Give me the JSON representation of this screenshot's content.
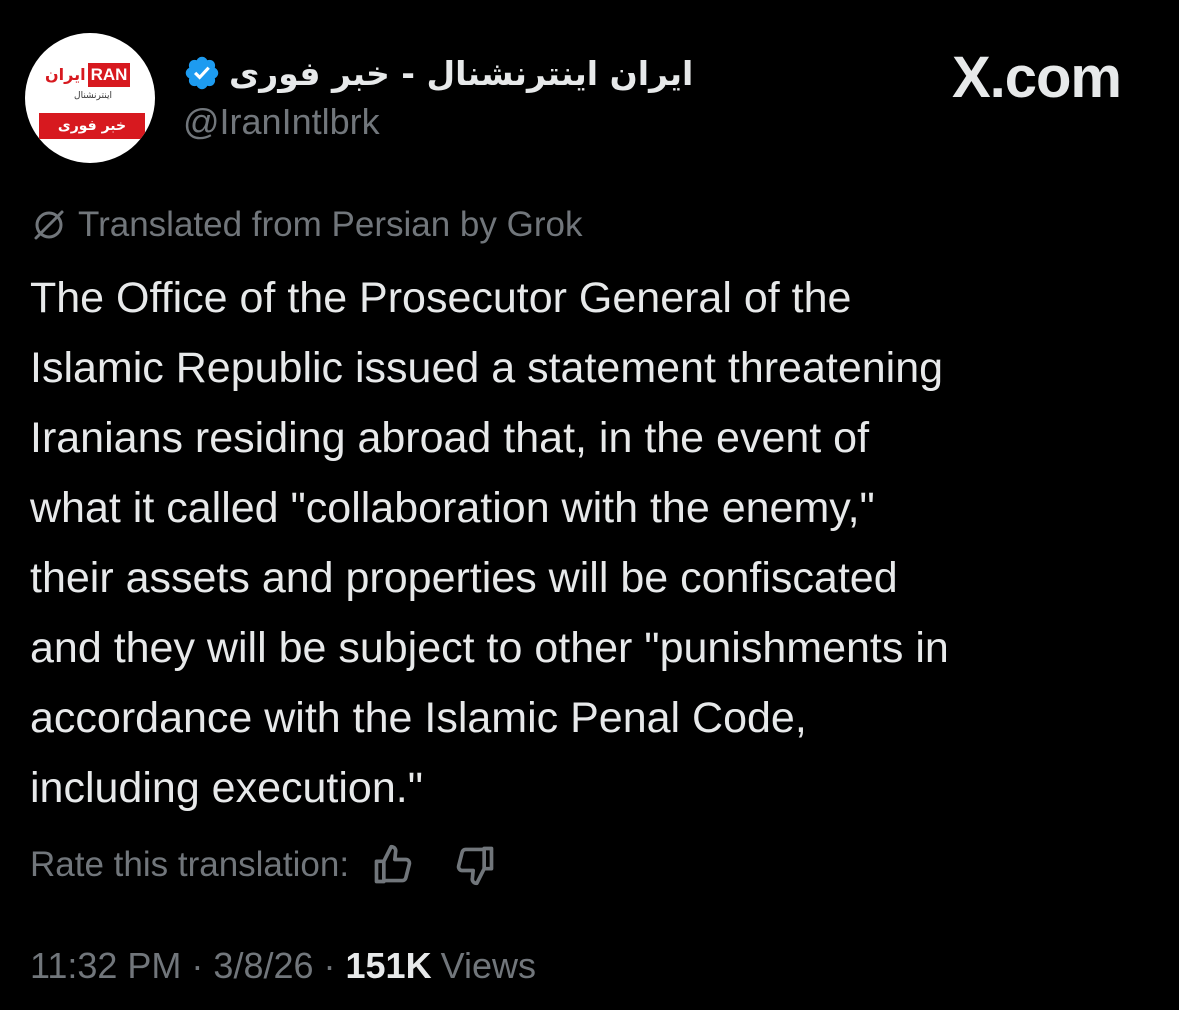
{
  "account": {
    "display_name": "ایران اینترنشنال - خبر فوری",
    "handle": "@IranIntlbrk",
    "avatar": {
      "logo_fa": "ایران",
      "logo_en": "RAN",
      "logo_sub": "اینترنشنال",
      "logo_band": "خبر فوری"
    },
    "verified_color": "#1d9bf0"
  },
  "brand": "X.com",
  "translation_notice": "Translated from Persian by Grok",
  "post_lines": [
    "The Office of the Prosecutor General of the",
    "Islamic Republic issued a statement threatening",
    "Iranians residing abroad that, in the event of",
    "what it called \"collaboration with the enemy,\"",
    "their assets and properties will be confiscated",
    "and they will be subject to other \"punishments in",
    "accordance with the Islamic Penal Code,",
    "including execution.\""
  ],
  "rate": {
    "label": "Rate this translation:",
    "up_icon": "thumbs-up-icon",
    "down_icon": "thumbs-down-icon"
  },
  "meta": {
    "time": "11:32 PM",
    "separator": "·",
    "date": "3/8/26",
    "views_count": "151K",
    "views_label": "Views"
  },
  "colors": {
    "background": "#000000",
    "primary_text": "#e7e9ea",
    "secondary_text": "#71767b",
    "logo_red": "#d7191f"
  }
}
